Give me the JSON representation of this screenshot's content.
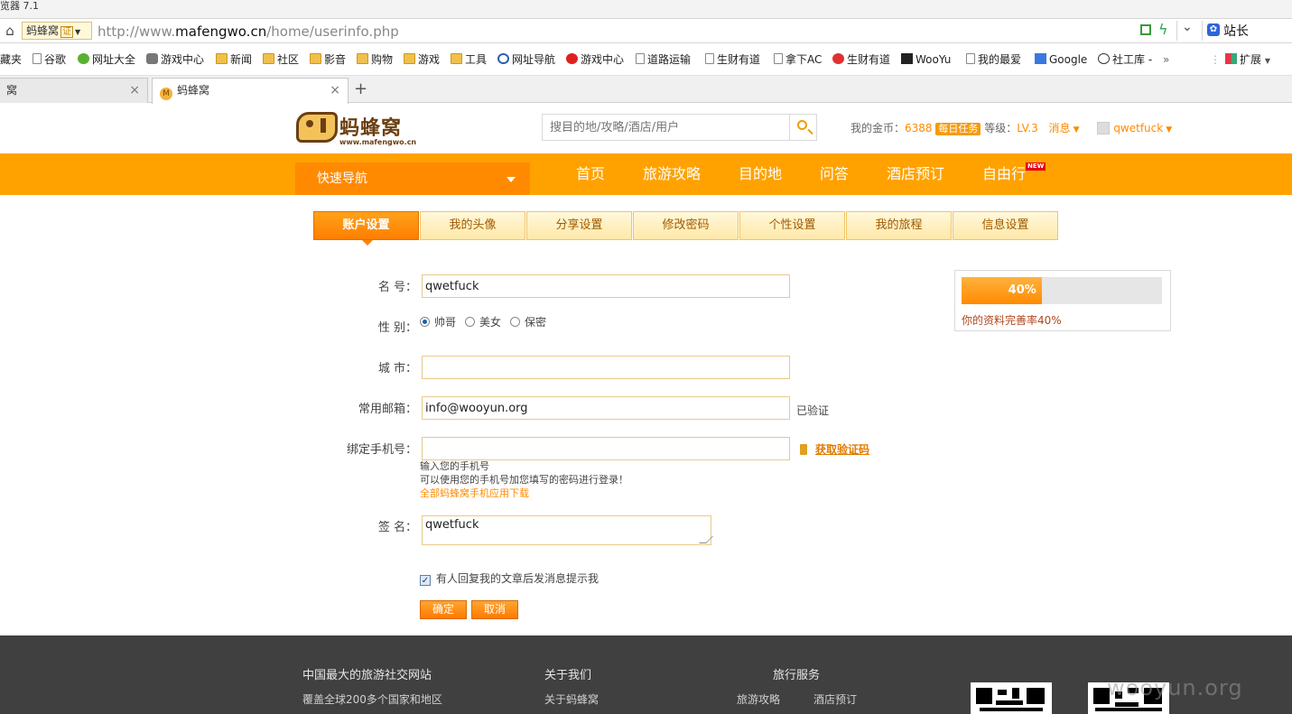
{
  "browser": {
    "title_fragment": "览器 7.1",
    "site_badge": "蚂蜂窝",
    "site_badge_cert": "证",
    "url_prefix": "http://www.",
    "url_domain": "mafengwo.cn",
    "url_path": "/home/userinfo.php",
    "toolbar_right_label": "站长",
    "bookmarks": [
      "藏夹",
      "谷歌",
      "网址大全",
      "游戏中心",
      "新闻",
      "社区",
      "影音",
      "购物",
      "游戏",
      "工具",
      "网址导航",
      "游戏中心",
      "道路运输",
      "生财有道",
      "拿下AC",
      "生财有道",
      "WooYu",
      "我的最爱",
      "Google",
      "社工库 -",
      "»",
      "扩展"
    ],
    "tabs": [
      {
        "label": "窝"
      },
      {
        "label": "蚂蜂窝"
      }
    ],
    "new_tab": "+"
  },
  "header": {
    "logo_text": "蚂蜂窝",
    "logo_domain": "www.mafengwo.cn",
    "search_placeholder": "搜目的地/攻略/酒店/用户",
    "coins_label": "我的金币：",
    "coins_value": "6388",
    "daily_task": "每日任务",
    "level_label": "等级：",
    "level_value": "LV.3",
    "messages": "消息",
    "username": "qwetfuck"
  },
  "nav": {
    "quick_nav": "快速导航",
    "items": [
      "首页",
      "旅游攻略",
      "目的地",
      "问答",
      "酒店预订",
      "自由行"
    ],
    "new_badge": "NEW"
  },
  "settings_tabs": [
    "账户设置",
    "我的头像",
    "分享设置",
    "修改密码",
    "个性设置",
    "我的旅程",
    "信息设置"
  ],
  "form": {
    "name_label": "名 号：",
    "name_value": "qwetfuck",
    "gender_label": "性 别：",
    "gender_options": [
      "帅哥",
      "美女",
      "保密"
    ],
    "gender_selected": "帅哥",
    "city_label": "城 市：",
    "city_value": "",
    "email_label": "常用邮箱：",
    "email_value": "info@wooyun.org",
    "email_status": "已验证",
    "phone_label": "绑定手机号：",
    "phone_value": "",
    "get_code": "获取验证码",
    "phone_hint1": "输入您的手机号",
    "phone_hint2": "可以使用您的手机号加您填写的密码进行登录！",
    "phone_app_link": "全部蚂蜂窝手机应用下载",
    "signature_label": "签 名：",
    "signature_value": "qwetfuck",
    "notify_checkbox": "有人回复我的文章后发消息提示我",
    "notify_checked": true,
    "confirm": "确定",
    "cancel": "取消"
  },
  "profile_progress": {
    "percent": 40,
    "percent_text": "40%",
    "caption": "你的资料完善率40%"
  },
  "footer": {
    "col1_title": "中国最大的旅游社交网站",
    "col1_text": "覆盖全球200多个国家和地区",
    "col2_title": "关于我们",
    "col2_link": "关于蚂蜂窝",
    "col3_title": "旅行服务",
    "col3_links": [
      "旅游攻略",
      "酒店预订"
    ]
  },
  "watermark": "wooyun.org",
  "colors": {
    "brand_orange": "#ffa200",
    "accent_orange": "#ff8a00",
    "footer_bg": "#404040"
  }
}
